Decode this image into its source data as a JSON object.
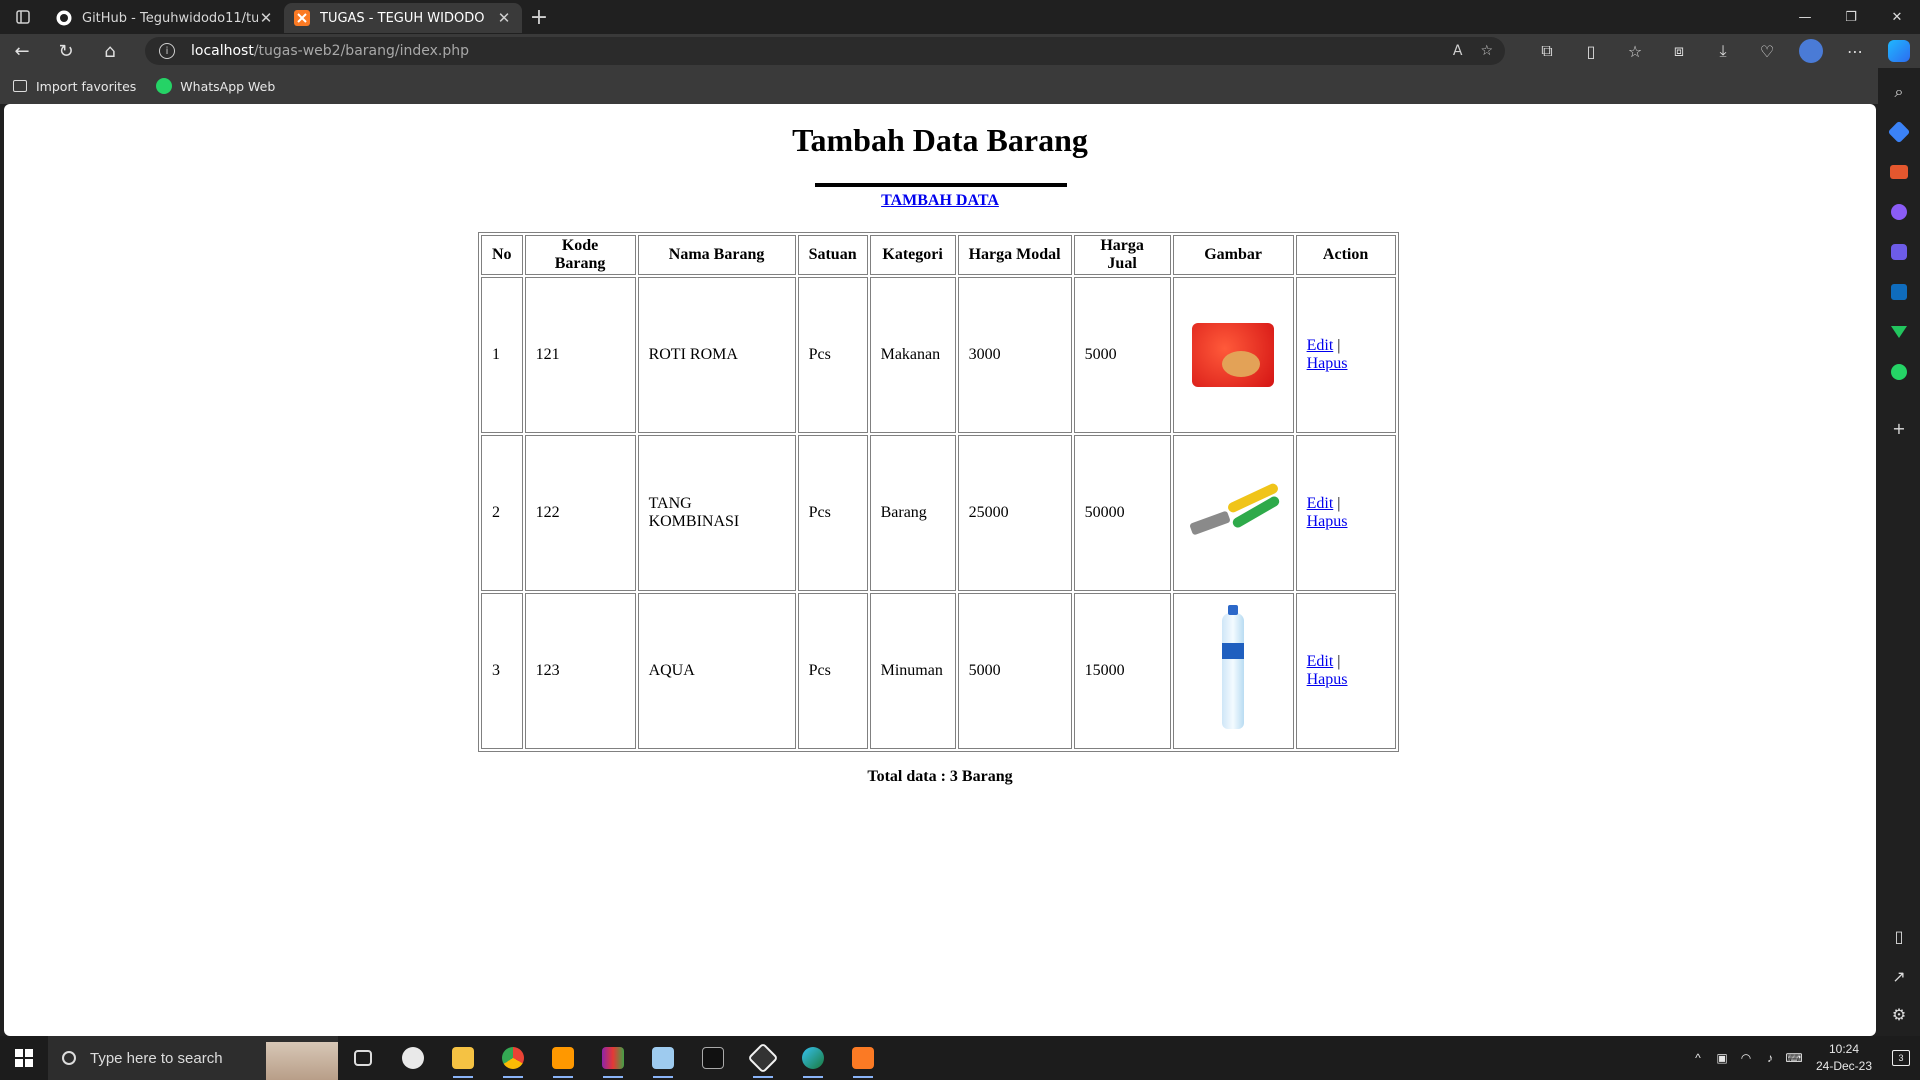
{
  "browser": {
    "tabs": [
      {
        "title": "GitHub - Teguhwidodo11/tugas-",
        "active": false,
        "icon": "github-icon"
      },
      {
        "title": "TUGAS - TEGUH WIDODO",
        "active": true,
        "icon": "xampp-icon"
      }
    ],
    "url_host": "localhost",
    "url_path": "/tugas-web2/barang/index.php",
    "read_aloud_label": "A",
    "favorites": [
      {
        "label": "Import favorites",
        "icon": "import-favorites-icon"
      },
      {
        "label": "WhatsApp Web",
        "icon": "whatsapp-icon"
      }
    ],
    "accent_color": "#2d6cf0"
  },
  "page": {
    "title": "Tambah Data Barang",
    "add_link": "TAMBAH DATA",
    "columns": [
      "No",
      "Kode Barang",
      "Nama Barang",
      "Satuan",
      "Kategori",
      "Harga Modal",
      "Harga Jual",
      "Gambar",
      "Action"
    ],
    "rows": [
      {
        "no": "1",
        "kode": "121",
        "nama": "ROTI ROMA",
        "satuan": "Pcs",
        "kategori": "Makanan",
        "modal": "3000",
        "jual": "5000",
        "gambar": "roti-roma-image",
        "edit": "Edit",
        "sep": "|",
        "hapus": "Hapus"
      },
      {
        "no": "2",
        "kode": "122",
        "nama": "TANG KOMBINASI",
        "satuan": "Pcs",
        "kategori": "Barang",
        "modal": "25000",
        "jual": "50000",
        "gambar": "tang-kombinasi-image",
        "edit": "Edit",
        "sep": "|",
        "hapus": "Hapus"
      },
      {
        "no": "3",
        "kode": "123",
        "nama": "AQUA",
        "satuan": "Pcs",
        "kategori": "Minuman",
        "modal": "5000",
        "jual": "15000",
        "gambar": "aqua-bottle-image",
        "edit": "Edit",
        "sep": "|",
        "hapus": "Hapus"
      }
    ],
    "total": "Total data : 3 Barang"
  },
  "taskbar": {
    "search_placeholder": "Type here to search",
    "time": "10:24",
    "date": "24-Dec-23",
    "notification_count": "3"
  }
}
